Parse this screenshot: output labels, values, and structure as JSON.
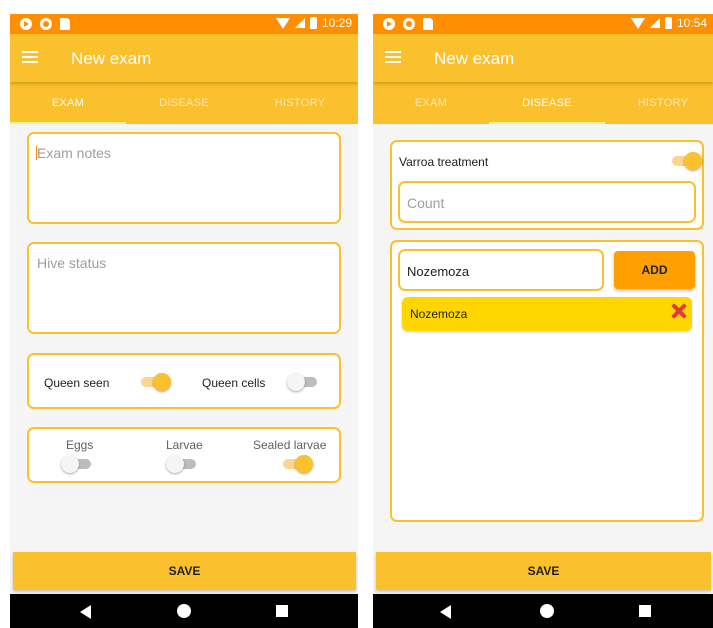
{
  "status_bar": {
    "time_left": "10:29",
    "time_right": "10:54"
  },
  "app_bar": {
    "title": "New exam"
  },
  "tabs": [
    {
      "label": "EXAM"
    },
    {
      "label": "DISEASE"
    },
    {
      "label": "HISTORY"
    }
  ],
  "exam_screen": {
    "active_tab": "EXAM",
    "exam_notes": {
      "placeholder": "Exam notes",
      "value": ""
    },
    "hive_status": {
      "placeholder": "Hive status",
      "value": ""
    },
    "queen_seen": {
      "label": "Queen seen",
      "on": true
    },
    "queen_cells": {
      "label": "Queen cells",
      "on": false
    },
    "eggs": {
      "label": "Eggs",
      "on": false
    },
    "larvae": {
      "label": "Larvae",
      "on": false
    },
    "sealed_larvae": {
      "label": "Sealed larvae",
      "on": true
    }
  },
  "disease_screen": {
    "active_tab": "DISEASE",
    "varroa_treatment": {
      "label": "Varroa treatment",
      "on": true
    },
    "count": {
      "placeholder": "Count",
      "value": ""
    },
    "disease_input": {
      "value": "Nozemoza"
    },
    "add_label": "ADD",
    "diseases": [
      {
        "name": "Nozemoza"
      }
    ]
  },
  "save_label": "SAVE",
  "colors": {
    "status_bar": "#ff8f00",
    "primary": "#fbc02d",
    "accent": "#ffa000",
    "chip": "#ffd600",
    "delete": "#e53935"
  }
}
